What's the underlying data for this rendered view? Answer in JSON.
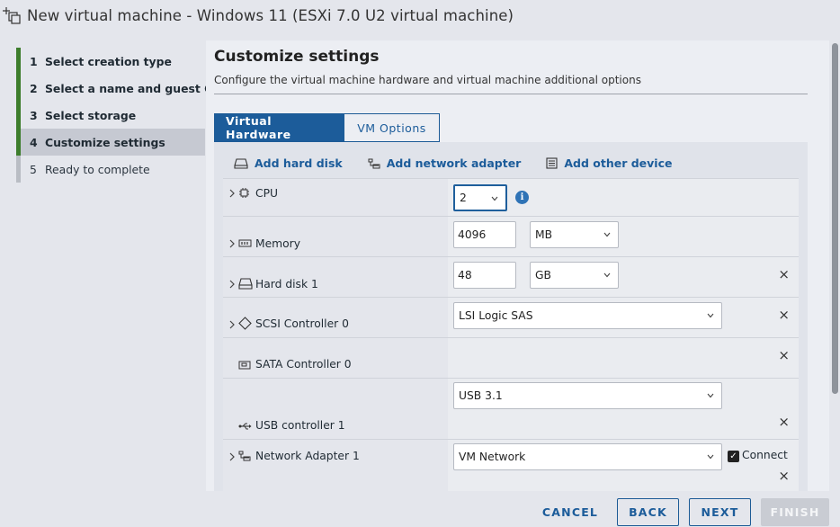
{
  "window": {
    "title": "New virtual machine - Windows 11 (ESXi 7.0 U2 virtual machine)"
  },
  "steps": [
    {
      "num": "1",
      "label": "Select creation type",
      "state": "done"
    },
    {
      "num": "2",
      "label": "Select a name and guest OS",
      "state": "done"
    },
    {
      "num": "3",
      "label": "Select storage",
      "state": "done"
    },
    {
      "num": "4",
      "label": "Customize settings",
      "state": "active"
    },
    {
      "num": "5",
      "label": "Ready to complete",
      "state": "pending"
    }
  ],
  "main": {
    "heading": "Customize settings",
    "subheading": "Configure the virtual machine hardware and virtual machine additional options",
    "tabs": [
      {
        "label": "Virtual Hardware",
        "selected": true
      },
      {
        "label": "VM Options",
        "selected": false
      }
    ],
    "actions": {
      "add_hard_disk": "Add hard disk",
      "add_network_adapter": "Add network adapter",
      "add_other_device": "Add other device"
    },
    "hardware": {
      "cpu": {
        "label": "CPU",
        "value": "2"
      },
      "memory": {
        "label": "Memory",
        "value": "4096",
        "unit": "MB"
      },
      "hard_disk": {
        "label": "Hard disk 1",
        "value": "48",
        "unit": "GB"
      },
      "scsi": {
        "label": "SCSI Controller 0",
        "value": "LSI Logic SAS"
      },
      "sata": {
        "label": "SATA Controller 0"
      },
      "usb": {
        "label": "USB controller 1",
        "value": "USB 3.1"
      },
      "network": {
        "label": "Network Adapter 1",
        "value": "VM Network",
        "connect_label": "Connect",
        "connected": true
      }
    },
    "close_glyph": "×",
    "check_glyph": "✓",
    "info_glyph": "i"
  },
  "footer": {
    "cancel": "CANCEL",
    "back": "BACK",
    "next": "NEXT",
    "finish": "FINISH"
  },
  "colors": {
    "accent": "#1c5c9a",
    "step_done": "#3d7d2c",
    "step_pending": "#b9bdc4"
  }
}
